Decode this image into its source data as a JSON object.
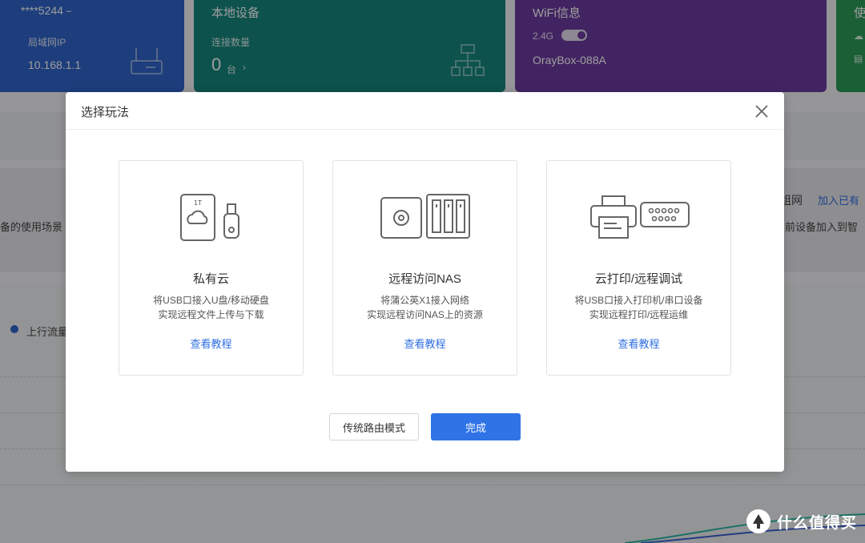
{
  "background": {
    "card_blue": {
      "top_text": "****5244",
      "label": "局域网IP",
      "value": "10.168.1.1"
    },
    "card_teal": {
      "title": "本地设备",
      "label": "连接数量",
      "count": "0",
      "unit": "台"
    },
    "card_purple": {
      "title": "WiFi信息",
      "band": "2.4G",
      "ssid": "OrayBox-088A"
    },
    "card_green": {
      "title": "使"
    },
    "side_text_1": "组网",
    "side_link": "加入已有",
    "side_text_2": "前设备加入到智",
    "left_text": "备的使用场景",
    "legend_label": "上行流量"
  },
  "modal": {
    "title": "选择玩法",
    "close_icon": "close-icon",
    "options": [
      {
        "icon": "cloud-storage-usb-icon",
        "icon_label": "1T",
        "title": "私有云",
        "desc_1": "将USB口接入U盘/移动硬盘",
        "desc_2": "实现远程文件上传与下载",
        "link": "查看教程"
      },
      {
        "icon": "nas-icon",
        "title": "远程访问NAS",
        "desc_1": "将蒲公英X1接入网络",
        "desc_2": "实现远程访问NAS上的资源",
        "link": "查看教程"
      },
      {
        "icon": "printer-serial-icon",
        "title": "云打印/远程调试",
        "desc_1": "将USB口接入打印机/串口设备",
        "desc_2": "实现远程打印/远程运维",
        "link": "查看教程"
      }
    ],
    "buttons": {
      "secondary": "传统路由模式",
      "primary": "完成"
    }
  },
  "watermark": {
    "text": "什么值得买",
    "icon": "zhi-logo-icon"
  },
  "colors": {
    "primary": "#2f73e6",
    "link": "#2f6fe0",
    "blue_card": "#2f63c9",
    "teal_card": "#16857d",
    "purple_card": "#6b3a9e",
    "green_card": "#2d9a57"
  }
}
